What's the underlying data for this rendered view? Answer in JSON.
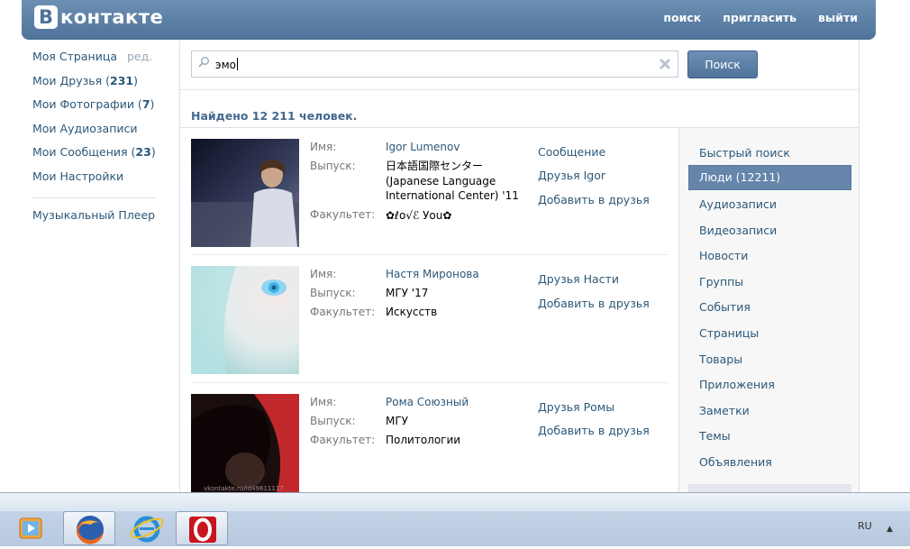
{
  "header": {
    "logo_letter": "B",
    "logo_text": "контакте",
    "nav": [
      "поиск",
      "пригласить",
      "выйти"
    ]
  },
  "leftmenu": {
    "my_page": "Моя Страница",
    "edit": "ред.",
    "friends": {
      "label": "Мои Друзья (",
      "count": "231",
      "close": ")"
    },
    "photos": {
      "label": "Мои Фотографии (",
      "count": "7",
      "close": ")"
    },
    "audio": "Мои Аудиозаписи",
    "messages": {
      "label": "Мои Сообщения (",
      "count": "23",
      "close": ")"
    },
    "settings": "Мои Настройки",
    "music_player": "Музыкальный Плеер"
  },
  "search": {
    "value": "эмо",
    "button": "Поиск",
    "found": "Найдено 12 211 человек."
  },
  "field_labels": {
    "name": "Имя:",
    "grad": "Выпуск:",
    "faculty": "Факультет:"
  },
  "results": [
    {
      "name": "Igor Lumenov",
      "graduation": "日本語国際センター (Japanese Language International Center) '11",
      "faculty": "✿ℓo√ℰ Уou✿",
      "actions": [
        "Сообщение",
        "Друзья Igor",
        "Добавить в друзья"
      ]
    },
    {
      "name": "Настя Миронова",
      "graduation": "МГУ '17",
      "faculty": "Искусств",
      "actions": [
        "Друзья Насти",
        "Добавить в друзья"
      ]
    },
    {
      "name": "Рома Союзный",
      "graduation": "МГУ",
      "faculty": "Политологии",
      "actions": [
        "Друзья Ромы",
        "Добавить в друзья"
      ],
      "photo_watermark": "vkontakte.ru/id49611117"
    }
  ],
  "filters": {
    "items": [
      "Быстрый поиск",
      "Люди (12211)",
      "Аудиозаписи",
      "Видеозаписи",
      "Новости",
      "Группы",
      "События",
      "Страницы",
      "Товары",
      "Приложения",
      "Заметки",
      "Темы",
      "Объявления"
    ],
    "active_index": 1
  },
  "taskbar": {
    "lang": "RU",
    "arrow": "▲"
  },
  "colors": {
    "header": "#5b7ea5",
    "link": "#2b587a",
    "active_filter": "#6585aa"
  }
}
